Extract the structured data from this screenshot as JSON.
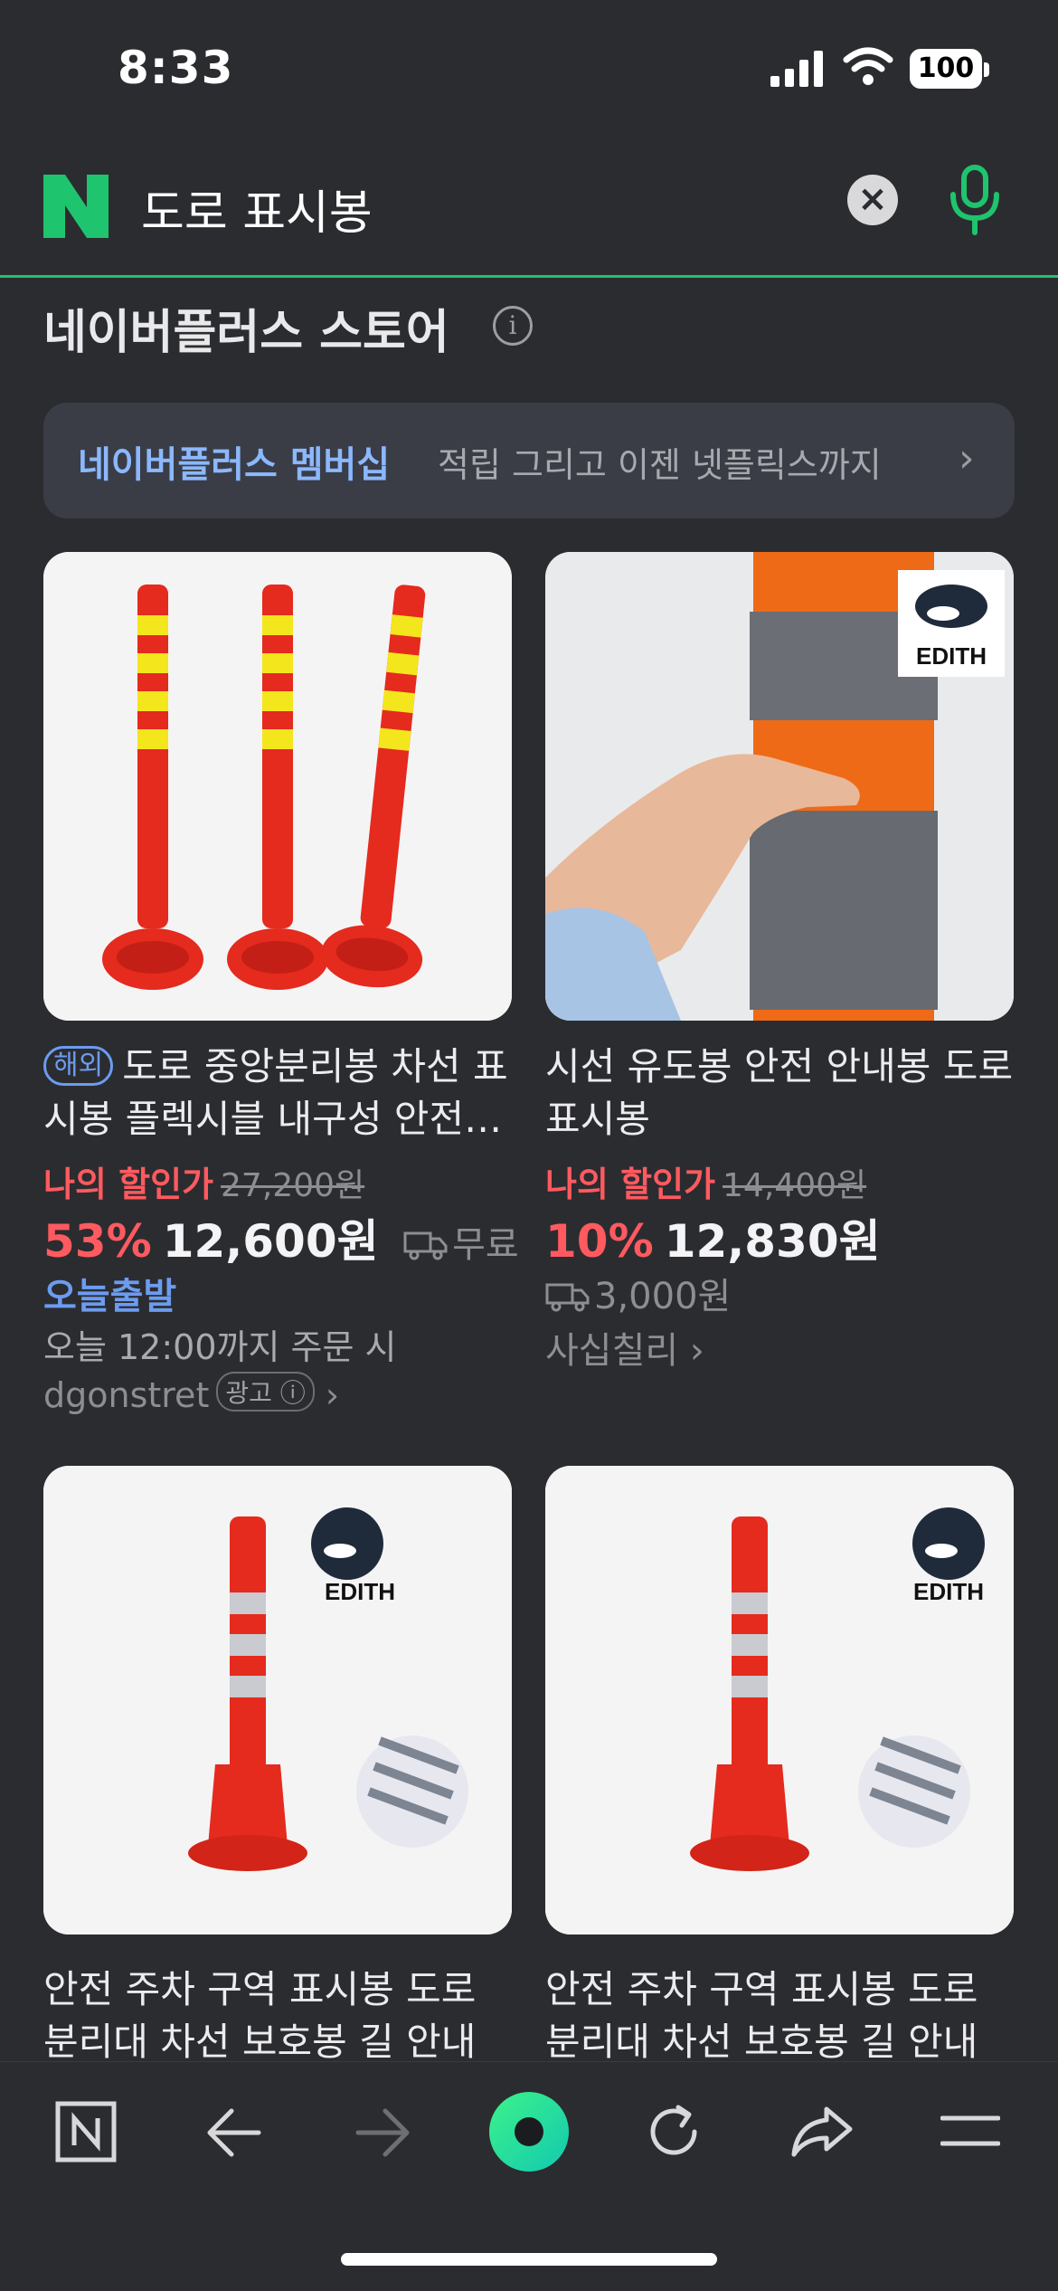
{
  "status_bar": {
    "time": "8:33",
    "battery": "100"
  },
  "search": {
    "query": "도로 표시봉"
  },
  "section": {
    "title": "네이버플러스 스토어"
  },
  "banner": {
    "main": "네이버플러스 멤버십",
    "sub": "적립 그리고 이젠 넷플릭스까지"
  },
  "products": [
    {
      "badge": "해외",
      "title": "도로 중앙분리봉 차선 표시봉 플렉시블 내구성 안전 관리",
      "discount_label": "나의 할인가",
      "original_price": "27,200원",
      "discount_pct": "53%",
      "price": "12,600원",
      "shipping": "무료",
      "delivery": "오늘출발",
      "delivery_note": "오늘 12:00까지 주문 시",
      "seller": "dgonstret",
      "ad_label": "광고"
    },
    {
      "title": "시선 유도봉 안전 안내봉 도로 표시봉",
      "discount_label": "나의 할인가",
      "original_price": "14,400원",
      "discount_pct": "10%",
      "price": "12,830원",
      "shipping": "3,000원",
      "seller": "사십칠리",
      "brand_logo": "EDITH"
    },
    {
      "title": "안전 주차 구역 표시봉 도로 분리대 차선 보호봉 길 안내",
      "brand_logo": "EDITH"
    },
    {
      "title": "안전 주차 구역 표시봉 도로 분리대 차선 보호봉 길 안내",
      "brand_logo": "EDITH"
    }
  ],
  "colors": {
    "accent_green": "#1ec46e",
    "discount_red": "#ff5a5f",
    "link_blue": "#6c9cf0",
    "bg": "#2b2c30"
  },
  "bottom_bar": {
    "icons": [
      "naver-home-icon",
      "back-icon",
      "forward-icon",
      "green-dot-icon",
      "refresh-icon",
      "share-icon",
      "menu-icon"
    ]
  }
}
